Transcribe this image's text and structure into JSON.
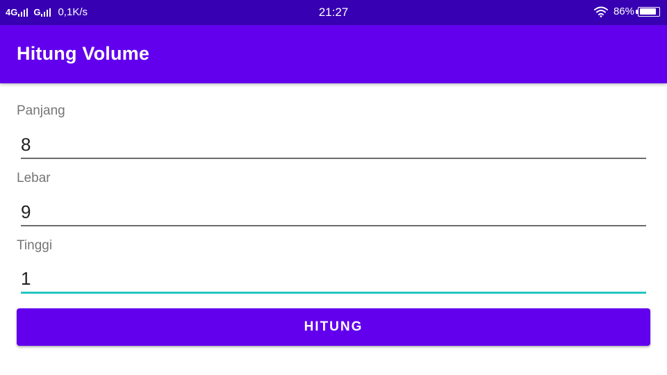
{
  "status_bar": {
    "network_1": "4G",
    "network_2": "G",
    "speed": "0,1K/s",
    "time": "21:27",
    "battery": "86%",
    "battery_level": 0.86,
    "icons": [
      "signal-icon",
      "wifi-icon",
      "battery-icon"
    ]
  },
  "app_bar": {
    "title": "Hitung Volume"
  },
  "form": {
    "fields": [
      {
        "label": "Panjang",
        "value": "8"
      },
      {
        "label": "Lebar",
        "value": "9"
      },
      {
        "label": "Tinggi",
        "value": "1"
      }
    ],
    "button_label": "HITUNG"
  },
  "colors": {
    "status_bar": "#3700B3",
    "primary": "#6200EE",
    "focus_accent": "#26C6C0",
    "label_gray": "#757575"
  }
}
